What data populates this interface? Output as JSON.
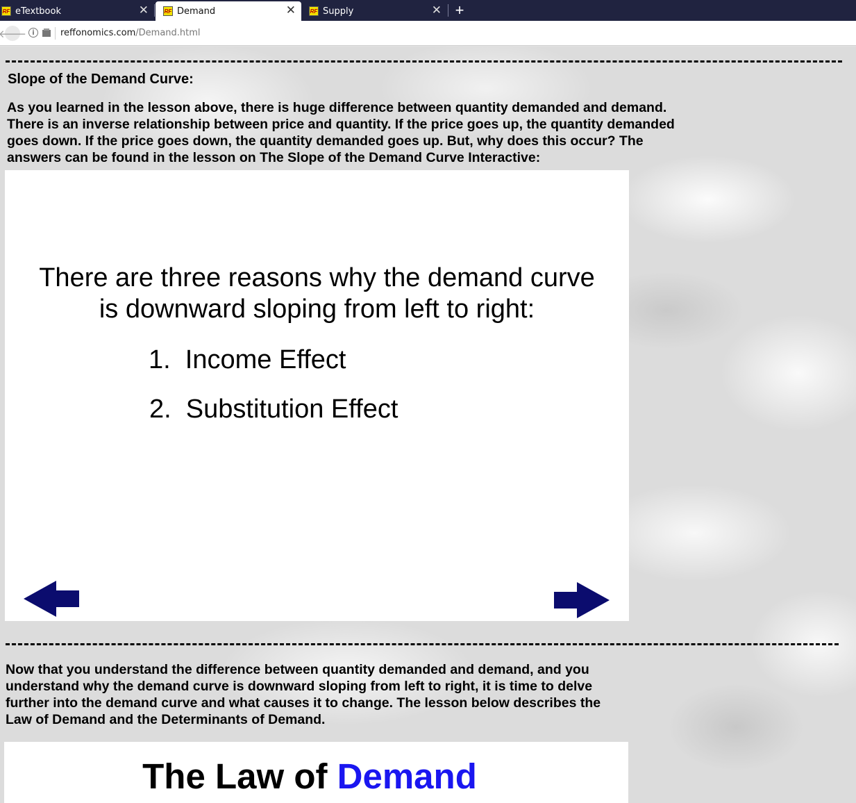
{
  "browser": {
    "tabs": [
      {
        "label": "eTextbook",
        "favicon": "RF"
      },
      {
        "label": "Demand",
        "favicon": "RF"
      },
      {
        "label": "Supply",
        "favicon": "RF"
      }
    ],
    "new_tab_label": "+",
    "url_host": "reffonomics.com",
    "url_path": "/Demand.html"
  },
  "section": {
    "heading": "Slope of the Demand Curve:",
    "intro": [
      "As you learned in the lesson above, there is huge difference between quantity demanded and demand.",
      "There is an inverse relationship between price and quantity.  If the price goes up, the quantity demanded",
      "goes down.  If the price goes down, the quantity demanded goes up.  But, why does this occur?  The",
      "answers can be found in the lesson on The Slope of the Demand Curve Interactive:"
    ]
  },
  "slide": {
    "line1": "There are three reasons why the demand curve",
    "line2": "is downward sloping from left to right:",
    "reasons": [
      "1.  Income Effect",
      "2.  Substitution Effect"
    ],
    "arrow_color": "#0b0c6e"
  },
  "next_section": {
    "paragraph": [
      "Now that you understand the difference between quantity demanded and demand, and you",
      "understand why the demand curve is downward sloping from left to right, it is time to delve",
      "further into the demand curve and what causes it to change.  The lesson below describes the",
      "Law of Demand and the Determinants of Demand."
    ],
    "law_title_prefix": "The Law of ",
    "law_title_highlight": "Demand",
    "highlight_color": "#1a16f0"
  }
}
